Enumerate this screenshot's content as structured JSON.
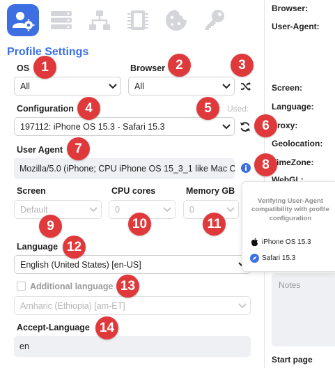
{
  "tabs": [
    {
      "icon": "user-settings-icon",
      "active": true
    },
    {
      "icon": "server-icon"
    },
    {
      "icon": "network-icon"
    },
    {
      "icon": "memory-chip-icon"
    },
    {
      "icon": "cookie-icon"
    },
    {
      "icon": "key-icon"
    }
  ],
  "title": "Profile Settings",
  "os": {
    "label": "OS",
    "value": "All"
  },
  "browser": {
    "label": "Browser",
    "value": "All"
  },
  "configuration": {
    "label": "Configuration",
    "used_label": "Used:",
    "value": "197112: iPhone OS 15.3 - Safari 15.3"
  },
  "user_agent": {
    "label": "User Agent",
    "value": "Mozilla/5.0 (iPhone; CPU iPhone OS 15_3_1 like Mac O"
  },
  "screen": {
    "label": "Screen",
    "value": "Default"
  },
  "cpu": {
    "label": "CPU cores",
    "value": "0"
  },
  "memory": {
    "label": "Memory GB",
    "value": "0"
  },
  "language": {
    "label": "Language",
    "value": "English (United States) [en-US]"
  },
  "additional_language": {
    "label": "Additional language",
    "value": "Amharic (Ethiopia) [am-ET]",
    "checked": false
  },
  "accept_language": {
    "label": "Accept-Language",
    "value": "en"
  },
  "right_panel": {
    "browser": "Browser:",
    "user_agent": "User-Agent:",
    "screen": "Screen:",
    "language": "Language:",
    "proxy": "Proxy:",
    "geolocation": "Geolocation:",
    "timezone": "TimeZone:",
    "webgl": "WebGL:",
    "notes_placeholder": "Notes",
    "start_page": "Start page"
  },
  "tooltip": {
    "message": "Verifying User-Agent compatibility with profile configuration",
    "os": "iPhone OS 15.3",
    "browser": "Safari 15.3"
  },
  "badges": [
    "1",
    "2",
    "3",
    "4",
    "5",
    "6",
    "7",
    "8",
    "9",
    "10",
    "11",
    "12",
    "13",
    "14"
  ],
  "colors": {
    "accent": "#3d6fe3",
    "badge": "#e0393b",
    "field_bg": "#eef0f3"
  }
}
